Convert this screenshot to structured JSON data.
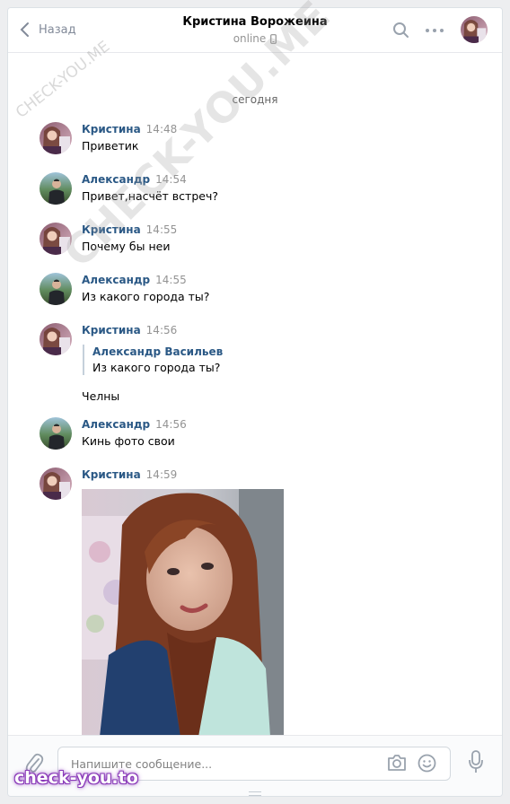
{
  "header": {
    "back_label": "Назад",
    "title": "Кристина Ворожеина",
    "status": "online"
  },
  "date_separator": "сегодня",
  "messages": [
    {
      "author": "Кристина",
      "time": "14:48",
      "text": "Приветик",
      "avatar": "kristina"
    },
    {
      "author": "Александр",
      "time": "14:54",
      "text": "Привет,насчёт встреч?",
      "avatar": "alexander"
    },
    {
      "author": "Кристина",
      "time": "14:55",
      "text": "Почему бы неи",
      "avatar": "kristina"
    },
    {
      "author": "Александр",
      "time": "14:55",
      "text": "Из какого города ты?",
      "avatar": "alexander"
    },
    {
      "author": "Кристина",
      "time": "14:56",
      "avatar": "kristina",
      "quote": {
        "author": "Александр Васильев",
        "text": "Из какого города ты?"
      },
      "text": "Челны"
    },
    {
      "author": "Александр",
      "time": "14:56",
      "text": "Кинь фото свои",
      "avatar": "alexander"
    },
    {
      "author": "Кристина",
      "time": "14:59",
      "avatar": "kristina",
      "attachment": "photo"
    }
  ],
  "composer": {
    "placeholder": "Напишите сообщение..."
  },
  "watermarks": {
    "diagonal": "CHECK-YOU.ME",
    "small": "CHECK-YOU.ME",
    "bottom": "check-you.to"
  },
  "colors": {
    "author_link": "#2a5885",
    "time": "#939393",
    "background": "#edeef0",
    "watermark_glow": "#8a3ab9"
  },
  "icons": [
    "back-arrow-icon",
    "phone-icon",
    "search-icon",
    "more-icon",
    "attach-icon",
    "camera-icon",
    "emoji-icon",
    "microphone-icon"
  ]
}
